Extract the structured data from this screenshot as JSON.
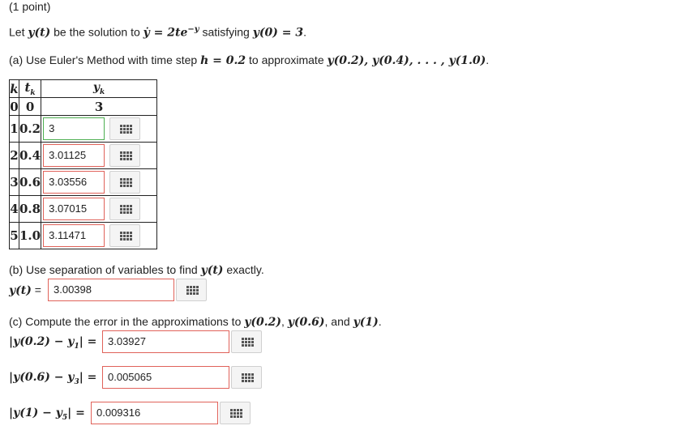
{
  "header": {
    "points": "(1 point)"
  },
  "intro": {
    "prefix": "Let ",
    "yt": "y(t)",
    "mid": " be the solution to ",
    "ode": "ẏ = 2te",
    "exp": "−y",
    "mid2": " satisfying ",
    "ic": "y(0) = 3",
    "end": "."
  },
  "part_a": {
    "prefix": "(a) Use Euler's Method with time step ",
    "h": "h = 0.2",
    "mid": " to approximate ",
    "targets": "y(0.2), y(0.4), . . . , y(1.0)",
    "end": "."
  },
  "table": {
    "headers": {
      "k": "k",
      "t": "t",
      "t_sub": "k",
      "y": "y",
      "y_sub": "k"
    },
    "row0": {
      "k": "0",
      "t": "0",
      "y": "3"
    },
    "rows": [
      {
        "k": "1",
        "t": "0.2",
        "value": "3"
      },
      {
        "k": "2",
        "t": "0.4",
        "value": "3.01125"
      },
      {
        "k": "3",
        "t": "0.6",
        "value": "3.03556"
      },
      {
        "k": "4",
        "t": "0.8",
        "value": "3.07015"
      },
      {
        "k": "5",
        "t": "1.0",
        "value": "3.11471"
      }
    ]
  },
  "part_b": {
    "prefix": "(b) Use separation of variables to find ",
    "yt": "y(t)",
    "end": " exactly.",
    "lhs": "y(t)",
    "eq": " = ",
    "value": "3.00398"
  },
  "part_c": {
    "prefix": "(c) Compute the error in the approximations to ",
    "t1": "y(0.2)",
    "sep1": ", ",
    "t2": "y(0.6)",
    "sep2": ", and ",
    "t3": "y(1)",
    "end": ".",
    "rows": [
      {
        "lhs_a": "|y(0.2) − y",
        "sub": "1",
        "lhs_b": "| = ",
        "value": "3.03927"
      },
      {
        "lhs_a": "|y(0.6) − y",
        "sub": "3",
        "lhs_b": "| = ",
        "value": "0.005065"
      },
      {
        "lhs_a": "|y(1) − y",
        "sub": "5",
        "lhs_b": "| = ",
        "value": "0.009316"
      }
    ]
  },
  "colors": {
    "wrong_border": "#e0625a",
    "correct_border": "#4caf50"
  },
  "icons": {
    "keypad": "grid-keypad-icon"
  }
}
